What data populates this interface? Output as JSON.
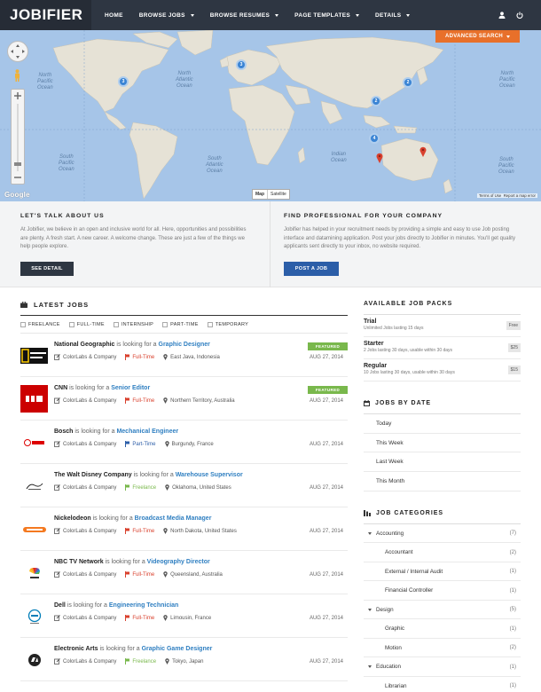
{
  "nav": {
    "logo": "JOBIFIER",
    "menu": [
      "HOME",
      "BROWSE JOBS",
      "BROWSE RESUMES",
      "PAGE TEMPLATES",
      "DETAILS"
    ],
    "icons": [
      "user-icon",
      "power-icon"
    ]
  },
  "map": {
    "advanced_search": "ADVANCED SEARCH",
    "map_label": "Map",
    "satellite_label": "Satellite",
    "google_label": "Google",
    "terms": "Terms of Use",
    "report": "Report a map error",
    "oceans": {
      "north_pacific": [
        "North",
        "Pacific",
        "Ocean"
      ],
      "north_atlantic": [
        "North",
        "Atlantic",
        "Ocean"
      ],
      "south_pacific": [
        "South",
        "Pacific",
        "Ocean"
      ],
      "south_atlantic": [
        "South",
        "Atlantic",
        "Ocean"
      ],
      "indian": [
        "Indian",
        "Ocean"
      ],
      "pacific_right": [
        "North",
        "Pacific",
        "Ocean"
      ],
      "south_pacific_right": [
        "South",
        "Pacific",
        "Ocean"
      ]
    },
    "clusters": [
      "3",
      "3",
      "2",
      "2",
      "4"
    ],
    "colors": {
      "ocean": "#a6c5e8",
      "land": "#e6e2d6",
      "cluster": "#3a84d4",
      "pin": "#d9412e"
    }
  },
  "info": {
    "left_title": "LET'S TALK ABOUT US",
    "left_text": "At Jobifier, we believe in an open and inclusive world for all. Here, opportunities and possibilities are plenty. A fresh start. A new career. A welcome change. These are just a few of the things we help people explore.",
    "left_button": "SEE DETAIL",
    "right_title": "FIND PROFESSIONAL FOR YOUR COMPANY",
    "right_text": "Jobifier has helped in your recruitment needs by providing a simple and easy to use Job posting interface and datamining application. Post your jobs directly to Jobifier in minutes. You'll get quality applicants sent directly to your inbox, no website required.",
    "right_button": "POST A JOB"
  },
  "latest": {
    "title": "LATEST JOBS",
    "filters": [
      "FREELANCE",
      "FULL-TIME",
      "INTERNSHIP",
      "PART-TIME",
      "TEMPORARY"
    ],
    "looking_for": "is looking for a",
    "jobs": [
      {
        "company": "National Geographic",
        "position": "Graphic Designer",
        "agency": "ColorLabs & Company",
        "type": "Full-Time",
        "type_color": "#d9412e",
        "location": "East Java, Indonesia",
        "date": "AUG 27, 2014",
        "featured": "FEATURED",
        "logo": "natgeo-logo"
      },
      {
        "company": "CNN",
        "position": "Senior Editor",
        "agency": "ColorLabs & Company",
        "type": "Full-Time",
        "type_color": "#d9412e",
        "location": "Northern Territory, Australia",
        "date": "AUG 27, 2014",
        "featured": "FEATURED",
        "logo": "cnn-logo"
      },
      {
        "company": "Bosch",
        "position": "Mechanical Engineer",
        "agency": "ColorLabs & Company",
        "type": "Part-Time",
        "type_color": "#2c5ea8",
        "location": "Burgundy, France",
        "date": "AUG 27, 2014",
        "featured": "",
        "logo": "bosch-logo"
      },
      {
        "company": "The Walt Disney Company",
        "position": "Warehouse Supervisor",
        "agency": "ColorLabs & Company",
        "type": "Freelance",
        "type_color": "#79b84c",
        "location": "Oklahoma, United States",
        "date": "AUG 27, 2014",
        "featured": "",
        "logo": "disney-logo"
      },
      {
        "company": "Nickelodeon",
        "position": "Broadcast Media Manager",
        "agency": "ColorLabs & Company",
        "type": "Full-Time",
        "type_color": "#d9412e",
        "location": "North Dakota, United States",
        "date": "AUG 27, 2014",
        "featured": "",
        "logo": "nickelodeon-logo"
      },
      {
        "company": "NBC TV Network",
        "position": "Videography Director",
        "agency": "ColorLabs & Company",
        "type": "Full-Time",
        "type_color": "#d9412e",
        "location": "Queensland, Australia",
        "date": "AUG 27, 2014",
        "featured": "",
        "logo": "nbc-logo"
      },
      {
        "company": "Dell",
        "position": "Engineering Technician",
        "agency": "ColorLabs & Company",
        "type": "Full-Time",
        "type_color": "#d9412e",
        "location": "Limousin, France",
        "date": "AUG 27, 2014",
        "featured": "",
        "logo": "dell-logo"
      },
      {
        "company": "Electronic Arts",
        "position": "Graphic Game Designer",
        "agency": "ColorLabs & Company",
        "type": "Freelance",
        "type_color": "#79b84c",
        "location": "Tokyo, Japan",
        "date": "AUG 27, 2014",
        "featured": "",
        "logo": "ea-logo"
      }
    ]
  },
  "sidebar": {
    "packs_title": "AVAILABLE JOB PACKS",
    "packs": [
      {
        "name": "Trial",
        "desc": "Unlimited Jobs lasting 15 days",
        "price": "Free"
      },
      {
        "name": "Starter",
        "desc": "2 Jobs lasting 30 days, usable within 30 days",
        "price": "$25"
      },
      {
        "name": "Regular",
        "desc": "10 Jobs lasting 30 days, usable within 30 days",
        "price": "$15"
      }
    ],
    "dates_title": "JOBS BY DATE",
    "dates": [
      "Today",
      "This Week",
      "Last Week",
      "This Month"
    ],
    "cats_title": "JOB CATEGORIES",
    "categories": [
      {
        "name": "Accounting",
        "count": "(7)",
        "level": "top"
      },
      {
        "name": "Accountant",
        "count": "(2)",
        "level": "sub"
      },
      {
        "name": "External / Internal Audit",
        "count": "(1)",
        "level": "sub"
      },
      {
        "name": "Financial Controller",
        "count": "(1)",
        "level": "sub"
      },
      {
        "name": "Design",
        "count": "(5)",
        "level": "top"
      },
      {
        "name": "Graphic",
        "count": "(1)",
        "level": "sub"
      },
      {
        "name": "Motion",
        "count": "(2)",
        "level": "sub"
      },
      {
        "name": "Education",
        "count": "(1)",
        "level": "top"
      },
      {
        "name": "Librarian",
        "count": "(1)",
        "level": "sub"
      }
    ]
  }
}
